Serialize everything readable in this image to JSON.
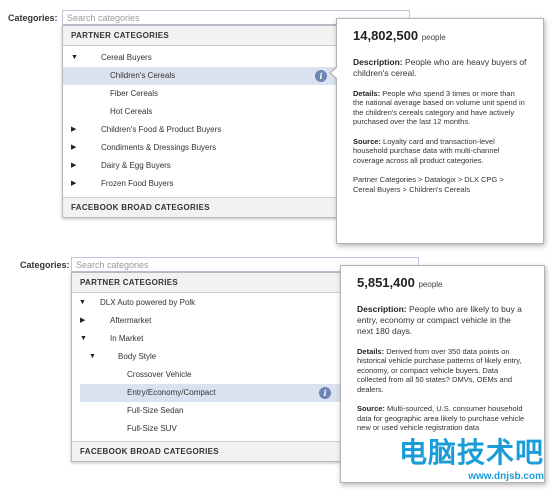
{
  "panel1": {
    "label": "Categories:",
    "search_placeholder": "Search categories",
    "header": "PARTNER CATEGORIES",
    "footer": "FACEBOOK BROAD CATEGORIES",
    "items": [
      {
        "label": "Cereal Buyers",
        "tri": "▼"
      },
      {
        "label": "Children's Cereals",
        "tri": ""
      },
      {
        "label": "Fiber Cereals",
        "tri": ""
      },
      {
        "label": "Hot Cereals",
        "tri": ""
      },
      {
        "label": "Children's Food & Product Buyers",
        "tri": "▶"
      },
      {
        "label": "Condiments & Dressings Buyers",
        "tri": "▶"
      },
      {
        "label": "Dairy & Egg Buyers",
        "tri": "▶"
      },
      {
        "label": "Frozen Food Buyers",
        "tri": "▶"
      }
    ],
    "tooltip": {
      "count": "14,802,500",
      "count_unit": "people",
      "desc_label": "Description:",
      "desc": "People who are heavy buyers of children's cereal.",
      "details_label": "Details:",
      "details": "People who spend 3 times or more than the national average based on volume unit spend in the children's cereals category and have actively purchased over the last 12 months.",
      "source_label": "Source:",
      "source": "Loyalty card and transaction-level household purchase data with multi-channel coverage across all product categories.",
      "path": "Partner Categories > Datalogix > DLX CPG > Cereal Buyers > Children's Cereals"
    }
  },
  "panel2": {
    "label": "Categories:",
    "search_placeholder": "Search categories",
    "header": "PARTNER CATEGORIES",
    "footer": "FACEBOOK BROAD CATEGORIES",
    "items": [
      {
        "label": "DLX Auto powered by Polk",
        "tri": "▼"
      },
      {
        "label": "Aftermarket",
        "tri": "▶"
      },
      {
        "label": "In Market",
        "tri": "▼"
      },
      {
        "label": "Body Style",
        "tri": "▼"
      },
      {
        "label": "Crossover Vehicle",
        "tri": ""
      },
      {
        "label": "Entry/Economy/Compact",
        "tri": ""
      },
      {
        "label": "Full-Size Sedan",
        "tri": ""
      },
      {
        "label": "Full-Size SUV",
        "tri": ""
      }
    ],
    "tooltip": {
      "count": "5,851,400",
      "count_unit": "people",
      "desc_label": "Description:",
      "desc": "People who are likely to buy a entry, economy or compact vehicle in the next 180 days.",
      "details_label": "Details:",
      "details": "Derived from over 350 data points on historical vehicle purchase patterns of likely entry, economy, or compact vehicle buyers. Data collected from all 50 states? DMVs, OEMs and dealers.",
      "source_label": "Source:",
      "source": "Multi-sourced, U.S. consumer household data for geographic area likely to purchase vehicle new or used vehicle registration data"
    }
  },
  "watermark": {
    "cn": "电脑技术吧",
    "url": "www.dnjsb.com"
  }
}
